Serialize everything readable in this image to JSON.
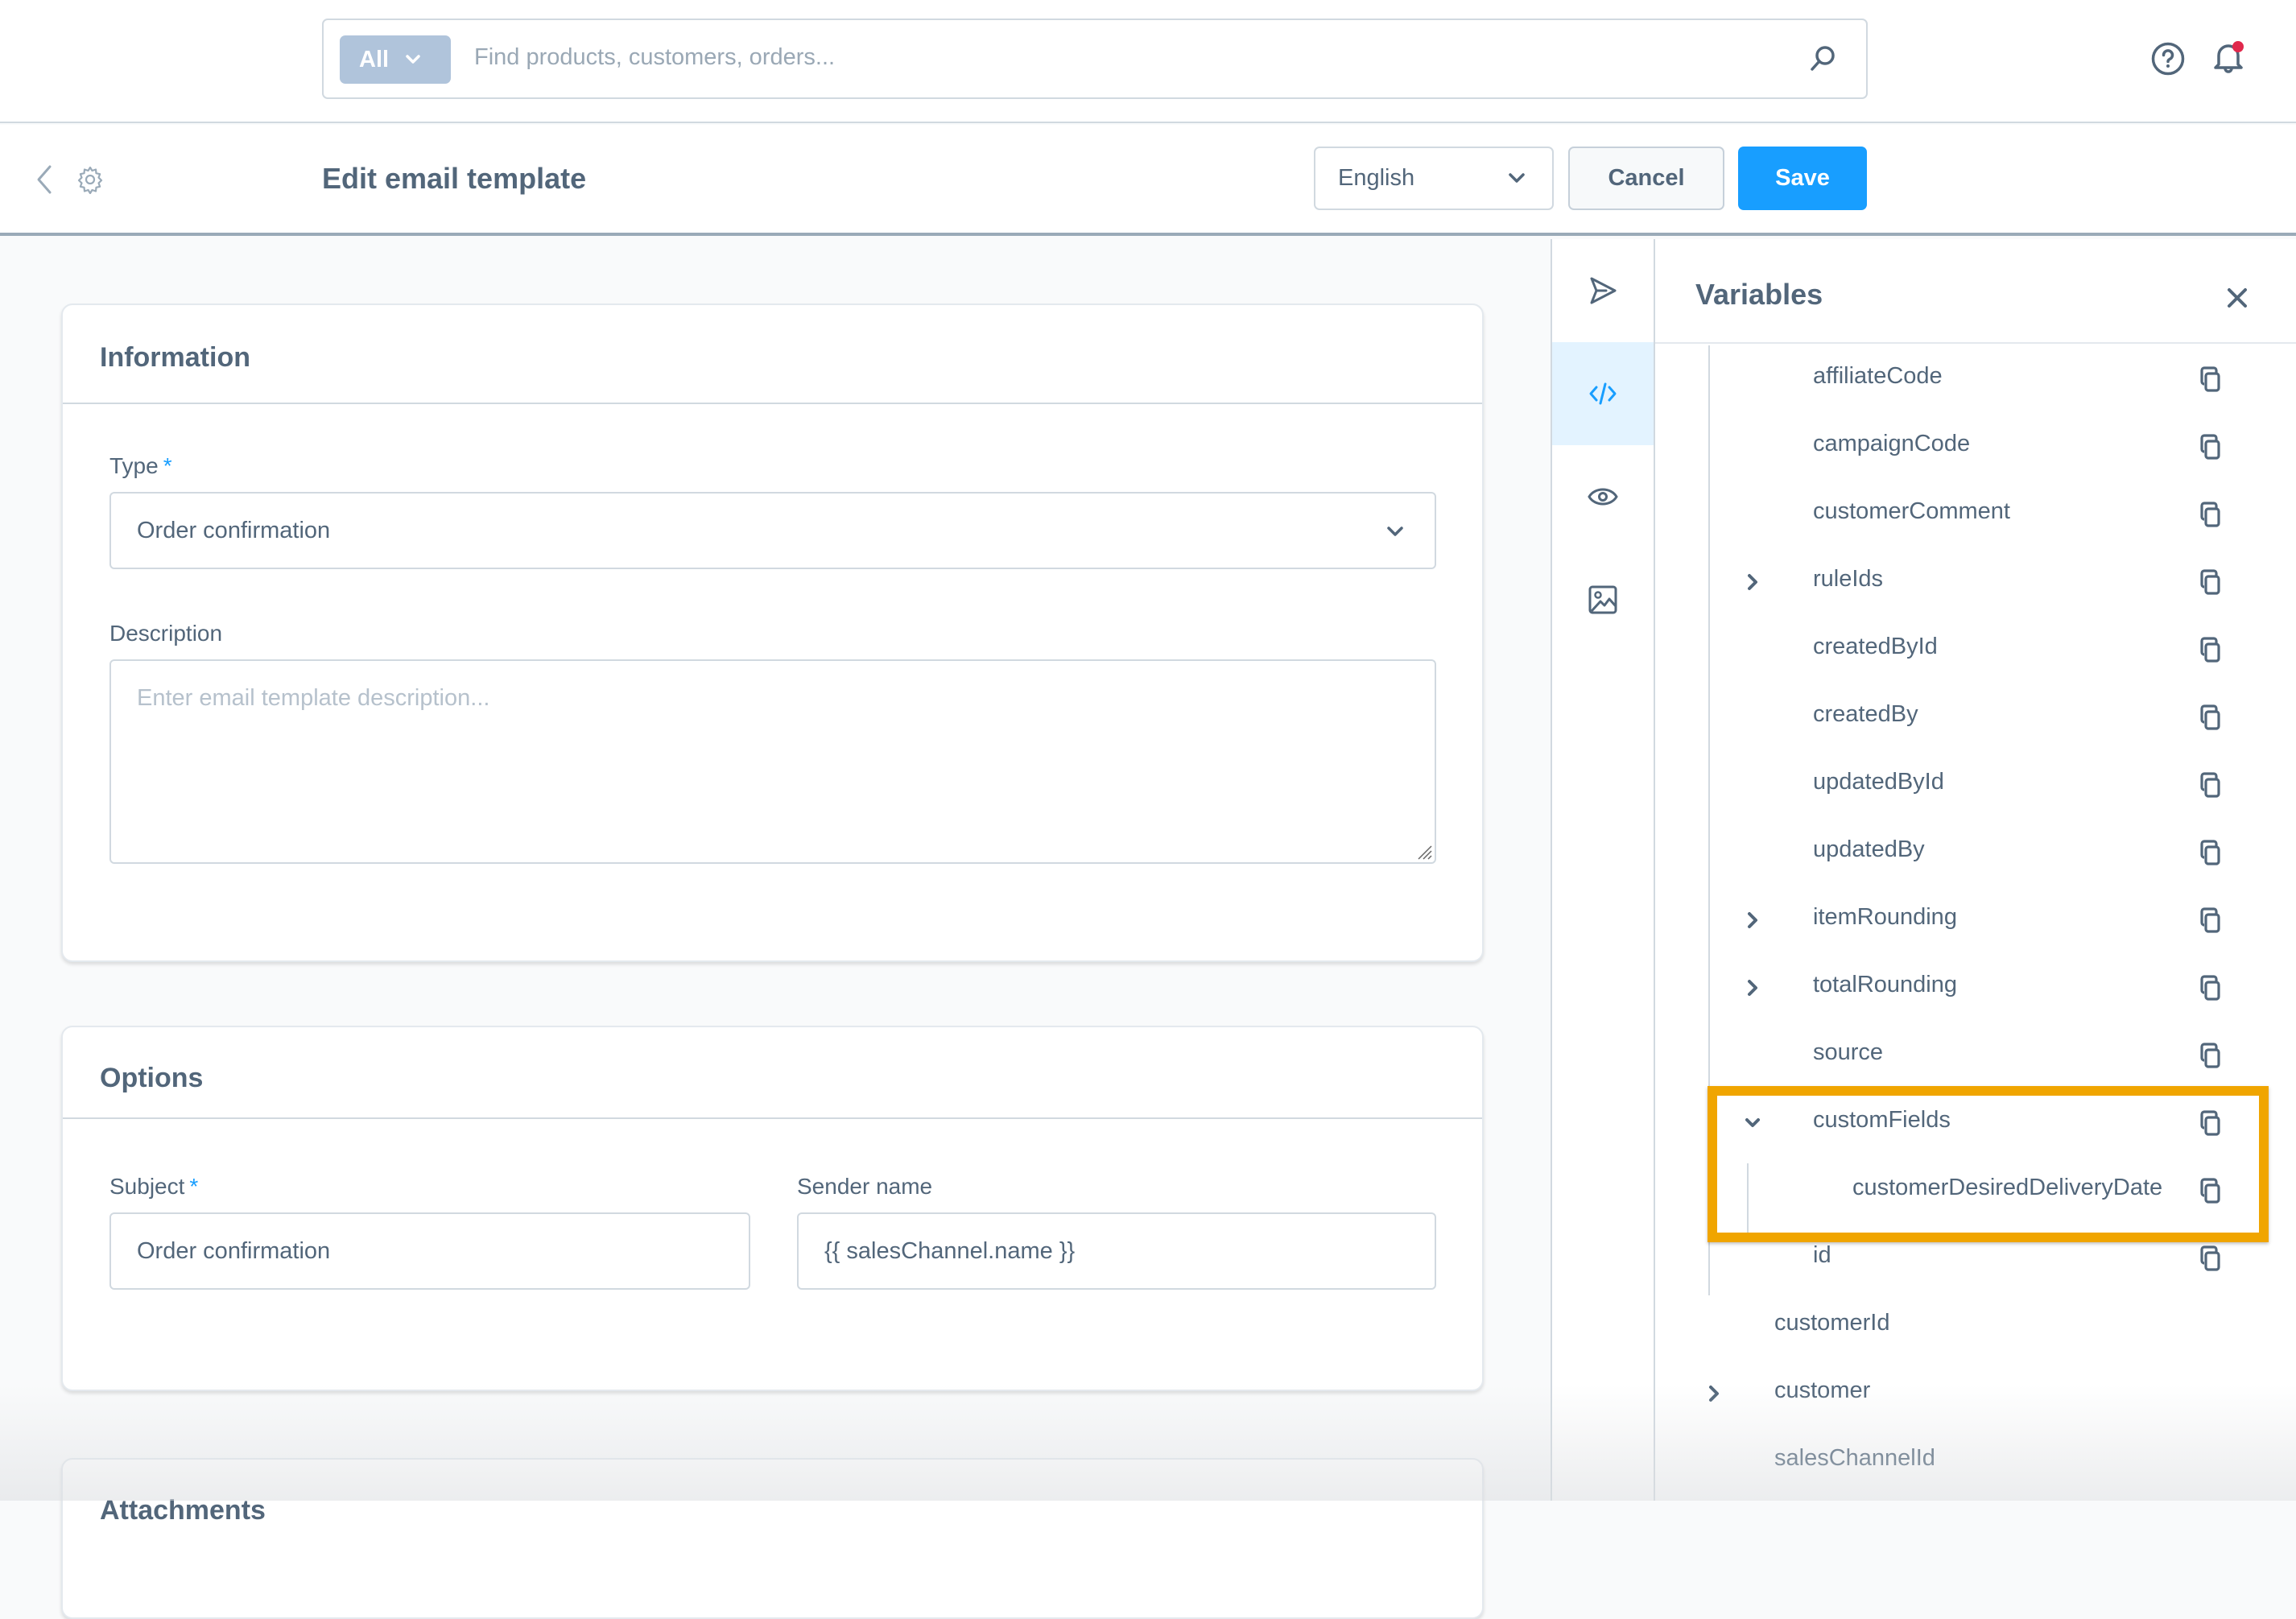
{
  "topbar": {
    "search_type": "All",
    "search_placeholder": "Find products, customers, orders...",
    "notification_dot_color": "#e0294c"
  },
  "header": {
    "title": "Edit email template",
    "language": "English",
    "cancel_label": "Cancel",
    "save_label": "Save"
  },
  "information": {
    "title": "Information",
    "type_label": "Type",
    "type_required": "*",
    "type_value": "Order confirmation",
    "description_label": "Description",
    "description_placeholder": "Enter email template description..."
  },
  "options": {
    "title": "Options",
    "subject_label": "Subject",
    "subject_required": "*",
    "subject_value": "Order confirmation",
    "sender_label": "Sender name",
    "sender_value": "{{ salesChannel.name }}"
  },
  "next_card": {
    "title": "Attachments"
  },
  "side_tabs": [
    {
      "name": "send-icon",
      "active": false
    },
    {
      "name": "code-icon",
      "active": true
    },
    {
      "name": "preview-icon",
      "active": false
    },
    {
      "name": "media-icon",
      "active": false
    }
  ],
  "variables": {
    "title": "Variables",
    "rows": [
      {
        "label": "affiliateCode",
        "expandable": false,
        "expanded": false,
        "level": 2
      },
      {
        "label": "campaignCode",
        "expandable": false,
        "expanded": false,
        "level": 2
      },
      {
        "label": "customerComment",
        "expandable": false,
        "expanded": false,
        "level": 2
      },
      {
        "label": "ruleIds",
        "expandable": true,
        "expanded": false,
        "level": 2
      },
      {
        "label": "createdById",
        "expandable": false,
        "expanded": false,
        "level": 2
      },
      {
        "label": "createdBy",
        "expandable": false,
        "expanded": false,
        "level": 2
      },
      {
        "label": "updatedById",
        "expandable": false,
        "expanded": false,
        "level": 2
      },
      {
        "label": "updatedBy",
        "expandable": false,
        "expanded": false,
        "level": 2
      },
      {
        "label": "itemRounding",
        "expandable": true,
        "expanded": false,
        "level": 2
      },
      {
        "label": "totalRounding",
        "expandable": true,
        "expanded": false,
        "level": 2
      },
      {
        "label": "source",
        "expandable": false,
        "expanded": false,
        "level": 2
      },
      {
        "label": "customFields",
        "expandable": true,
        "expanded": true,
        "level": 2
      },
      {
        "label": "customerDesiredDeliveryDate",
        "expandable": false,
        "expanded": false,
        "level": 3
      },
      {
        "label": "id",
        "expandable": false,
        "expanded": false,
        "level": 2
      },
      {
        "label": "customerId",
        "expandable": false,
        "expanded": false,
        "level": 1
      },
      {
        "label": "customer",
        "expandable": true,
        "expanded": false,
        "level": 1
      },
      {
        "label": "salesChannelId",
        "expandable": false,
        "expanded": false,
        "level": 1
      }
    ],
    "highlight_color": "#f0a500"
  },
  "colors": {
    "primary": "#189eff",
    "text": "#52667a",
    "border": "#d1d9e0",
    "search_type_bg": "#b0c4db"
  }
}
